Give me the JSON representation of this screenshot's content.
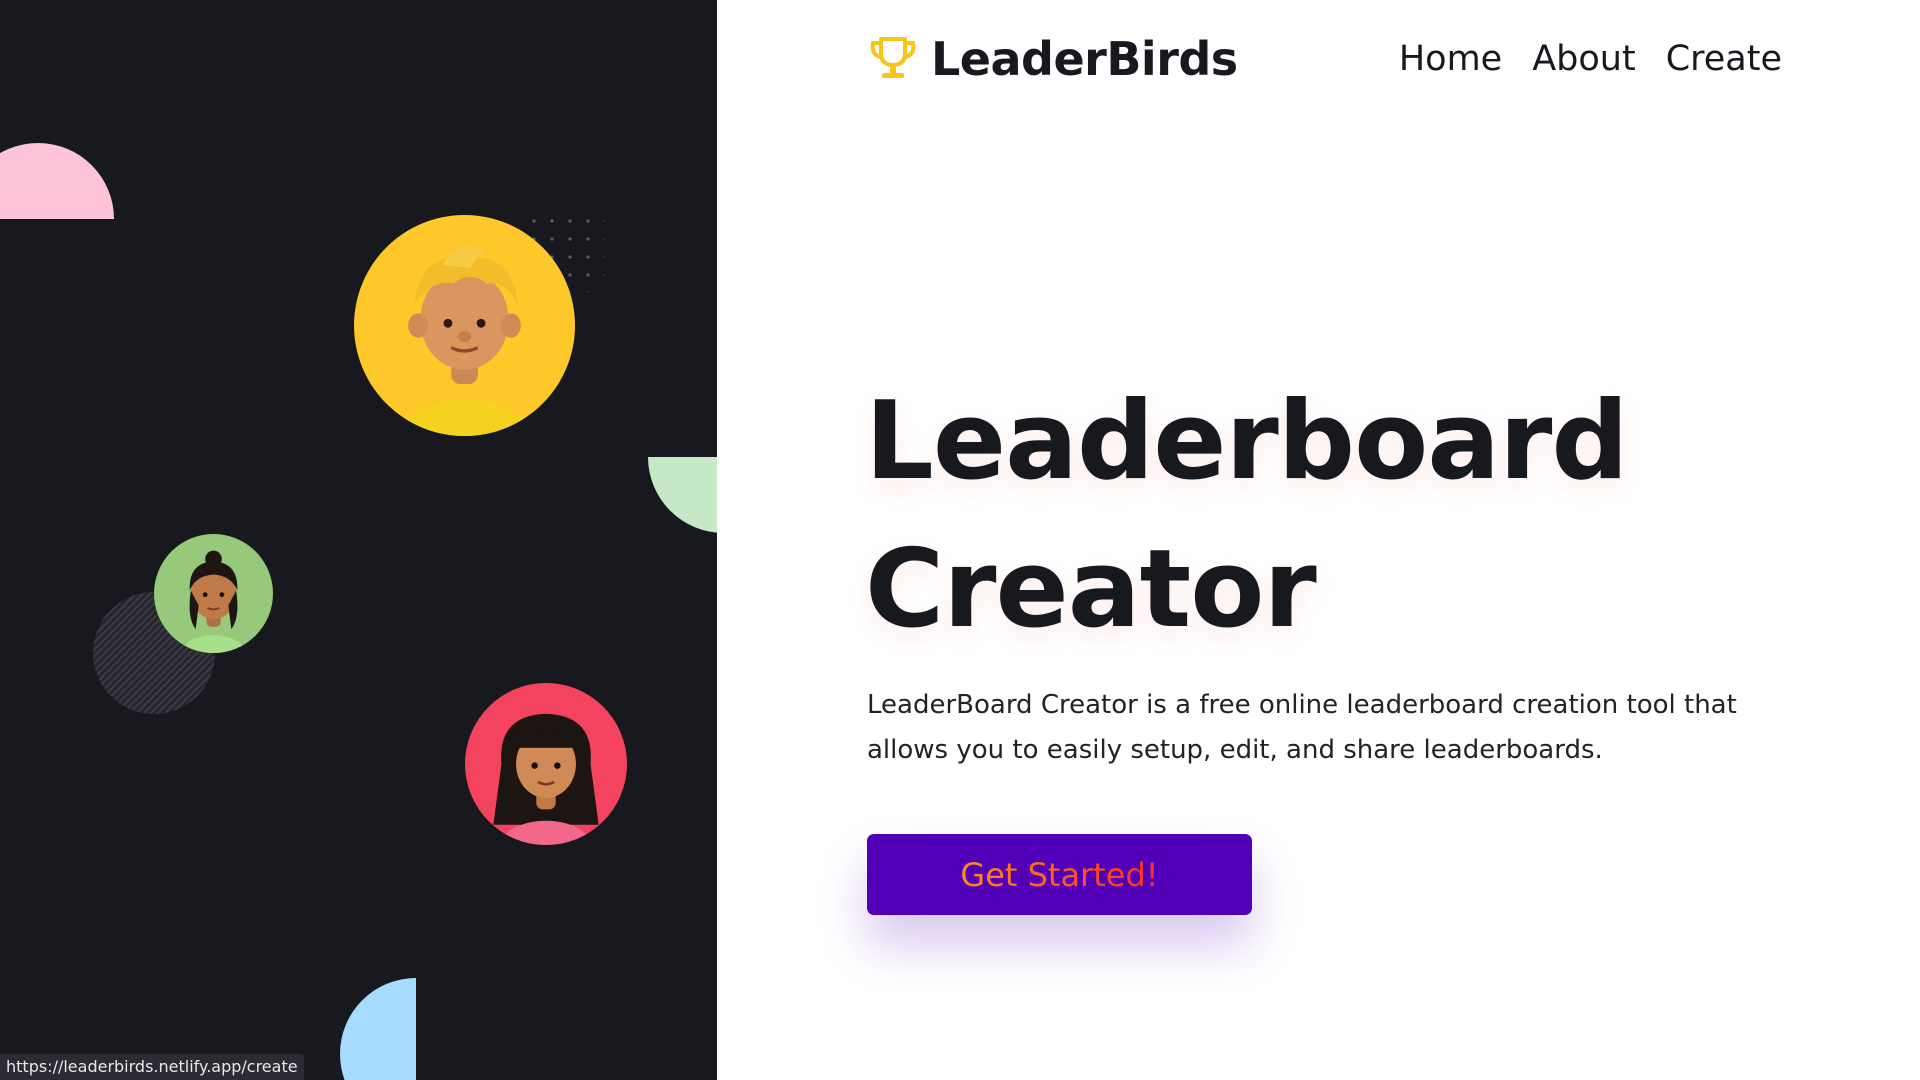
{
  "brand": {
    "name": "LeaderBirds",
    "icon": "trophy-icon",
    "icon_color": "#f5c518"
  },
  "nav": {
    "items": [
      {
        "label": "Home"
      },
      {
        "label": "About"
      },
      {
        "label": "Create"
      }
    ]
  },
  "hero": {
    "title_line1": "Leaderboard",
    "title_line2": "Creator",
    "description": "LeaderBoard Creator is a free online leaderboard creation tool that allows you to easily setup, edit, and share leaderboards.",
    "cta_label": "Get Started!"
  },
  "status_bar": {
    "url": "https://leaderbirds.netlify.app/create"
  },
  "colors": {
    "left_panel_bg": "#18181f",
    "cta_bg": "#5100b8",
    "cta_text": "#ff7a1a",
    "avatar_yellow": "#fec72a",
    "avatar_green": "#96c97a",
    "avatar_red": "#f4435e",
    "shape_pink": "#fdc3d8",
    "shape_green": "#c5e8c5",
    "shape_blue": "#a6dcff"
  }
}
